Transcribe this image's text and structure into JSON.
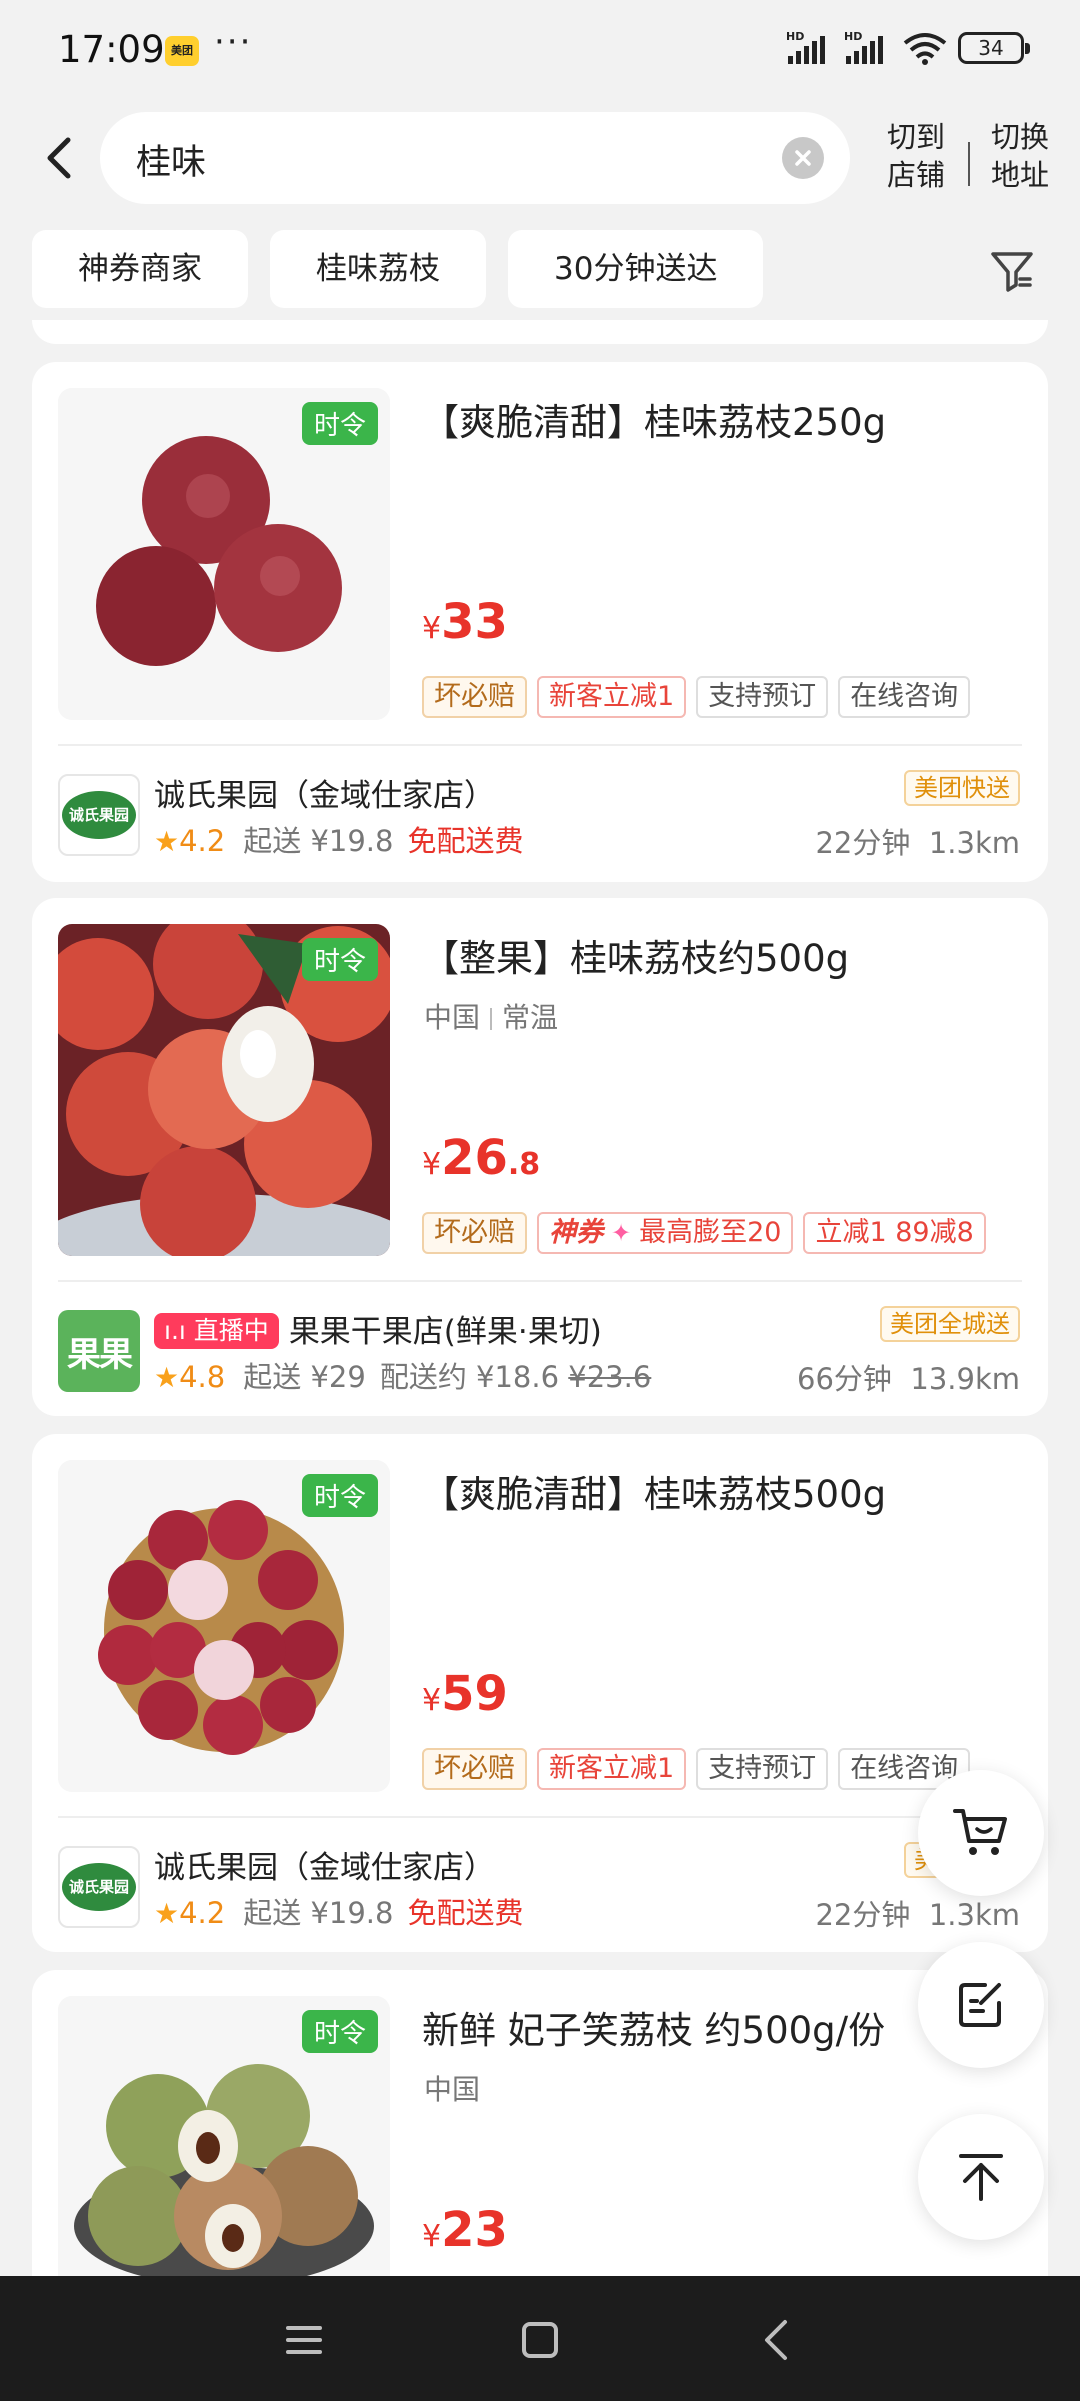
{
  "status_bar": {
    "time": "17:09",
    "app_badge": "美团",
    "more": "···",
    "signal_label_1": "HD",
    "signal_label_2": "HD",
    "battery": "34"
  },
  "search": {
    "query": "桂味"
  },
  "header_actions": {
    "switch_to_shop": "切到店铺",
    "switch_address": "切换地址"
  },
  "filters": [
    "神券商家",
    "桂味荔枝",
    "30分钟送达"
  ],
  "products": [
    {
      "season_tag": "时令",
      "title": "【爽脆清甜】桂味荔枝250g",
      "meta": [],
      "price_symbol": "¥",
      "price_int": "33",
      "price_dec": "",
      "tags": [
        "坏必赔",
        "新客立减1",
        "支持预订",
        "在线咨询"
      ],
      "store": {
        "logo_text": "诚氏果园",
        "name": "诚氏果园（金域仕家店）",
        "rating": "4.2",
        "min_order": "起送 ¥19.8",
        "delivery_fee": "免配送费",
        "badge": "美团快送",
        "time": "22分钟",
        "distance": "1.3km"
      }
    },
    {
      "season_tag": "时令",
      "title": "【整果】桂味荔枝约500g",
      "meta": [
        "中国",
        "常温"
      ],
      "price_symbol": "¥",
      "price_int": "26",
      "price_dec": ".8",
      "tags": [
        "坏必赔",
        "最高膨至20",
        "立减1 89减8"
      ],
      "coupon_label": "神券",
      "store": {
        "logo_text": "果果",
        "live_label": "直播中",
        "name": "果果干果店(鲜果·果切)",
        "rating": "4.8",
        "min_order": "起送 ¥29",
        "delivery_fee_label": "配送约 ¥18.6",
        "delivery_fee_original": "¥23.6",
        "badge": "美团全城送",
        "time": "66分钟",
        "distance": "13.9km"
      }
    },
    {
      "season_tag": "时令",
      "title": "【爽脆清甜】桂味荔枝500g",
      "meta": [],
      "price_symbol": "¥",
      "price_int": "59",
      "price_dec": "",
      "tags": [
        "坏必赔",
        "新客立减1",
        "支持预订",
        "在线咨询"
      ],
      "store": {
        "logo_text": "诚氏果园",
        "name": "诚氏果园（金域仕家店）",
        "rating": "4.2",
        "min_order": "起送 ¥19.8",
        "delivery_fee": "免配送费",
        "badge": "美团快送",
        "time": "22分钟",
        "distance": "1.3km"
      }
    },
    {
      "season_tag": "时令",
      "title": "新鲜 妃子笑荔枝 约500g/份",
      "meta": [
        "中国"
      ],
      "price_symbol": "¥",
      "price_int": "23",
      "price_dec": ""
    }
  ],
  "floating_buttons": [
    "cart-icon",
    "edit-note-icon",
    "back-to-top-icon"
  ],
  "nav_bar": [
    "menu-icon",
    "home-icon",
    "back-icon"
  ],
  "colors": {
    "price_red": "#e8332a",
    "season_green": "#3bb54a",
    "rating_orange": "#f08c16",
    "background": "#f2f2f2"
  }
}
